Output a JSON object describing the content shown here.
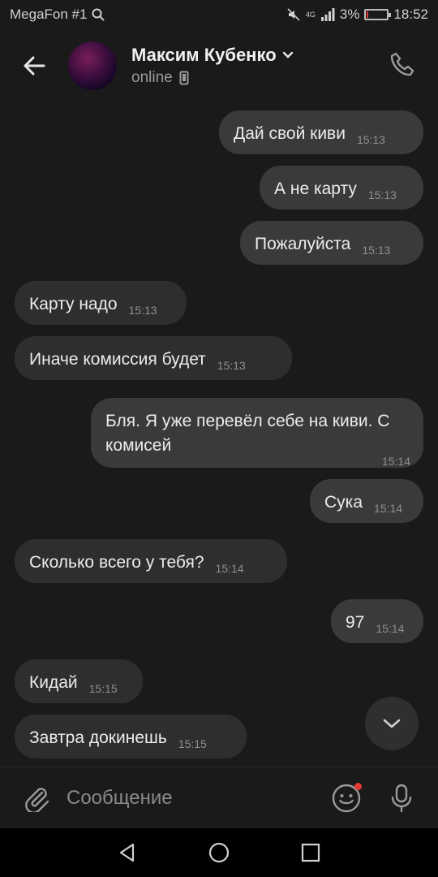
{
  "status_bar": {
    "carrier": "MegaFon #1",
    "network": "4G",
    "battery": "3%",
    "battery_level": 0.03,
    "time": "18:52"
  },
  "header": {
    "contact_name": "Максим Кубенко",
    "status": "online"
  },
  "messages": [
    {
      "text": "Дай свой киви",
      "time": "15:13",
      "direction": "out"
    },
    {
      "text": "А не карту",
      "time": "15:13",
      "direction": "out"
    },
    {
      "text": "Пожалуйста",
      "time": "15:13",
      "direction": "out"
    },
    {
      "text": "Карту надо",
      "time": "15:13",
      "direction": "in"
    },
    {
      "text": "Иначе комиссия будет",
      "time": "15:13",
      "direction": "in"
    },
    {
      "text": "Бля. Я уже перевёл себе на киви. С комисей",
      "time": "15:14",
      "direction": "out"
    },
    {
      "text": "Сука",
      "time": "15:14",
      "direction": "out"
    },
    {
      "text": "Сколько всего у тебя?",
      "time": "15:14",
      "direction": "in"
    },
    {
      "text": "97",
      "time": "15:14",
      "direction": "out"
    },
    {
      "text": "Кидай",
      "time": "15:15",
      "direction": "in"
    },
    {
      "text": "Завтра докинешь",
      "time": "15:15",
      "direction": "in"
    }
  ],
  "input": {
    "placeholder": "Сообщение",
    "value": ""
  },
  "icons": {
    "back": "arrow-left-icon",
    "call": "phone-icon",
    "attach": "paperclip-icon",
    "emoji": "smiley-icon",
    "mic": "microphone-icon",
    "scroll_down": "chevron-down-icon"
  },
  "colors": {
    "background": "#1a1a1a",
    "bubble_in": "#2e2e2e",
    "bubble_out": "#3a3a3a",
    "notification_dot": "#e53935"
  }
}
